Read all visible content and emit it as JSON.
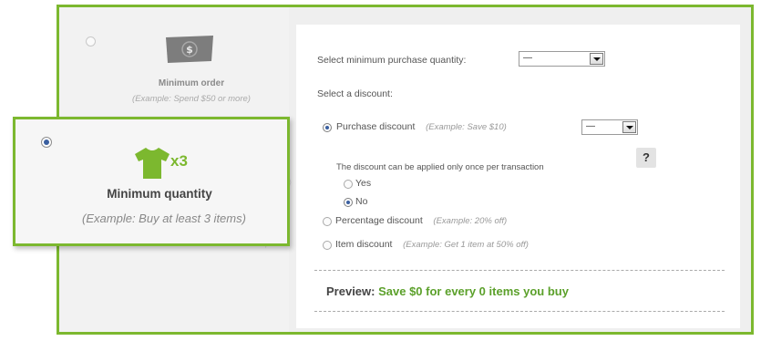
{
  "options": {
    "minimum_order": {
      "title": "Minimum order",
      "example": "(Example: Spend $50 or more)",
      "icon": "dollar-bill-icon"
    },
    "minimum_quantity": {
      "title": "Minimum quantity",
      "example": "(Example: Buy at least 3 items)",
      "icon": "tshirt-icon",
      "multiplier": "x3",
      "selected": true
    }
  },
  "panel": {
    "min_qty_label": "Select minimum purchase quantity:",
    "min_qty_value": "—",
    "select_discount_label": "Select a discount:",
    "discounts": {
      "purchase": {
        "label": "Purchase discount",
        "example": "(Example: Save $10)",
        "value": "—"
      },
      "percentage": {
        "label": "Percentage discount",
        "example": "(Example: 20% off)"
      },
      "item": {
        "label": "Item discount",
        "example": "(Example: Get 1 item at 50% off)"
      }
    },
    "once_text": "The discount can be applied only once per transaction",
    "yes_label": "Yes",
    "no_label": "No",
    "help_label": "?",
    "preview_label": "Preview:",
    "preview_text": "Save $0 for every 0 items you buy"
  },
  "colors": {
    "accent": "#7cb82f",
    "preview_green": "#5ba02a"
  }
}
